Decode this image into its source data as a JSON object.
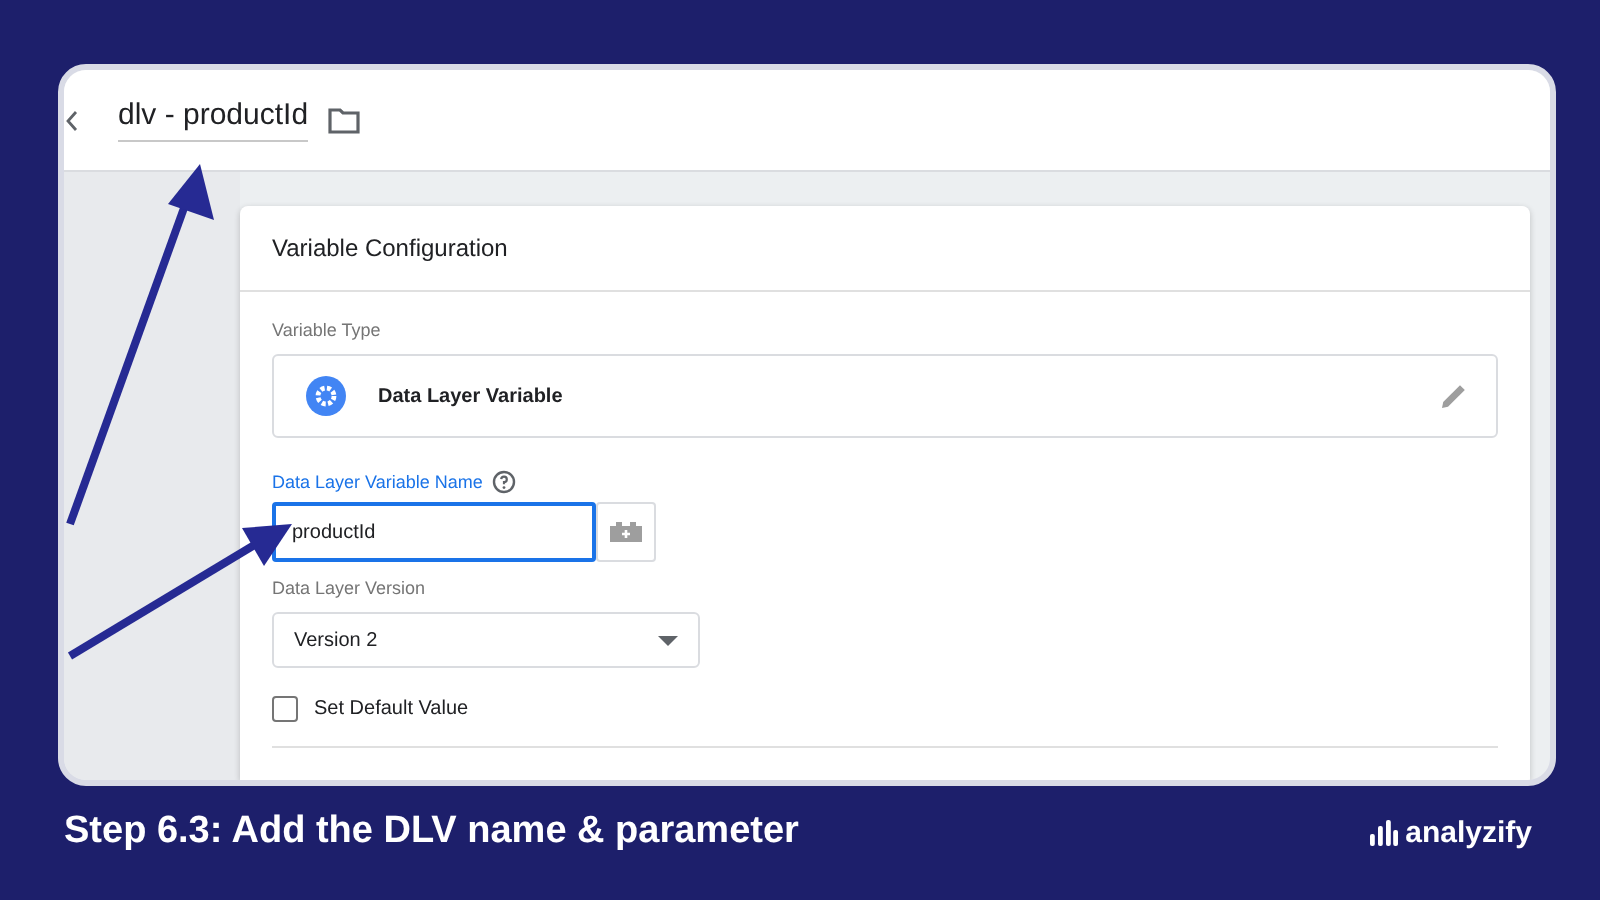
{
  "header": {
    "title": "dlv - productId"
  },
  "card": {
    "title": "Variable Configuration",
    "variable_type": {
      "label": "Variable Type",
      "value": "Data Layer Variable"
    },
    "name_field": {
      "label": "Data Layer Variable Name",
      "value": "productId",
      "focused": true
    },
    "version_field": {
      "label": "Data Layer Version",
      "value": "Version 2"
    },
    "default_value": {
      "label": "Set Default Value",
      "checked": false
    }
  },
  "caption": "Step 6.3: Add the DLV name & parameter",
  "brand": "analyzify"
}
